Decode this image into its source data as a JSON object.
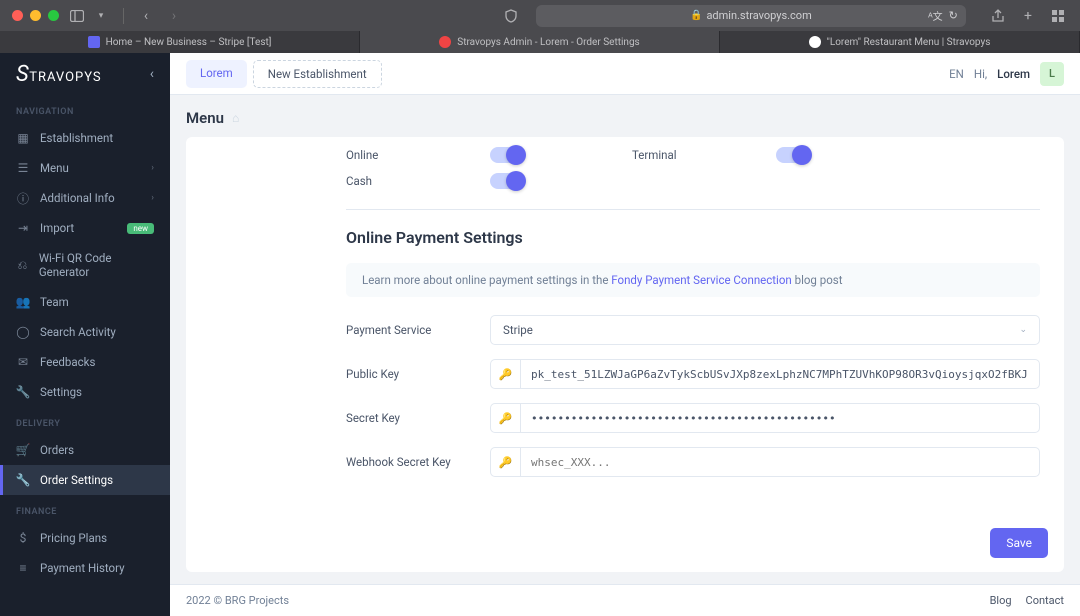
{
  "browser": {
    "url": "admin.stravopys.com",
    "tabs": [
      {
        "label": "Home – New Business – Stripe [Test]"
      },
      {
        "label": "Stravopys Admin - Lorem - Order Settings"
      },
      {
        "label": "\"Lorem\" Restaurant Menu | Stravopys"
      }
    ]
  },
  "logo": "STRAVOPYS",
  "sidebar": {
    "sections": {
      "navigation": "NAVIGATION",
      "delivery": "DELIVERY",
      "finance": "FINANCE"
    },
    "items": {
      "establishment": "Establishment",
      "menu": "Menu",
      "additional_info": "Additional Info",
      "import": "Import",
      "import_badge": "new",
      "wifi": "Wi-Fi QR Code Generator",
      "team": "Team",
      "search_activity": "Search Activity",
      "feedbacks": "Feedbacks",
      "settings": "Settings",
      "orders": "Orders",
      "order_settings": "Order Settings",
      "pricing_plans": "Pricing Plans",
      "payment_history": "Payment History"
    }
  },
  "topbar": {
    "tab1": "Lorem",
    "tab2": "New Establishment",
    "lang": "EN",
    "greeting": "Hi,",
    "user": "Lorem",
    "avatar": "L"
  },
  "page_title": "Menu",
  "toggles": {
    "online": "Online",
    "terminal": "Terminal",
    "cash": "Cash"
  },
  "section_title": "Online Payment Settings",
  "banner": {
    "pre": "Learn more about online payment settings in the ",
    "link": "Fondy Payment Service Connection",
    "post": " blog post"
  },
  "form": {
    "payment_service_label": "Payment Service",
    "payment_service_value": "Stripe",
    "public_key_label": "Public Key",
    "public_key_value": "pk_test_51LZWJaGP6aZvTykScbUSvJXp8zexLphzNC7MPhTZUVhKOP98OR3vQioysjqxO2fBKJ",
    "secret_key_label": "Secret Key",
    "secret_key_value": "••••••••••••••••••••••••••••••••••••••••••••••",
    "webhook_key_label": "Webhook Secret Key",
    "webhook_key_placeholder": "whsec_XXX..."
  },
  "save": "Save",
  "footer": {
    "copyright": "2022 © BRG Projects",
    "blog": "Blog",
    "contact": "Contact"
  }
}
